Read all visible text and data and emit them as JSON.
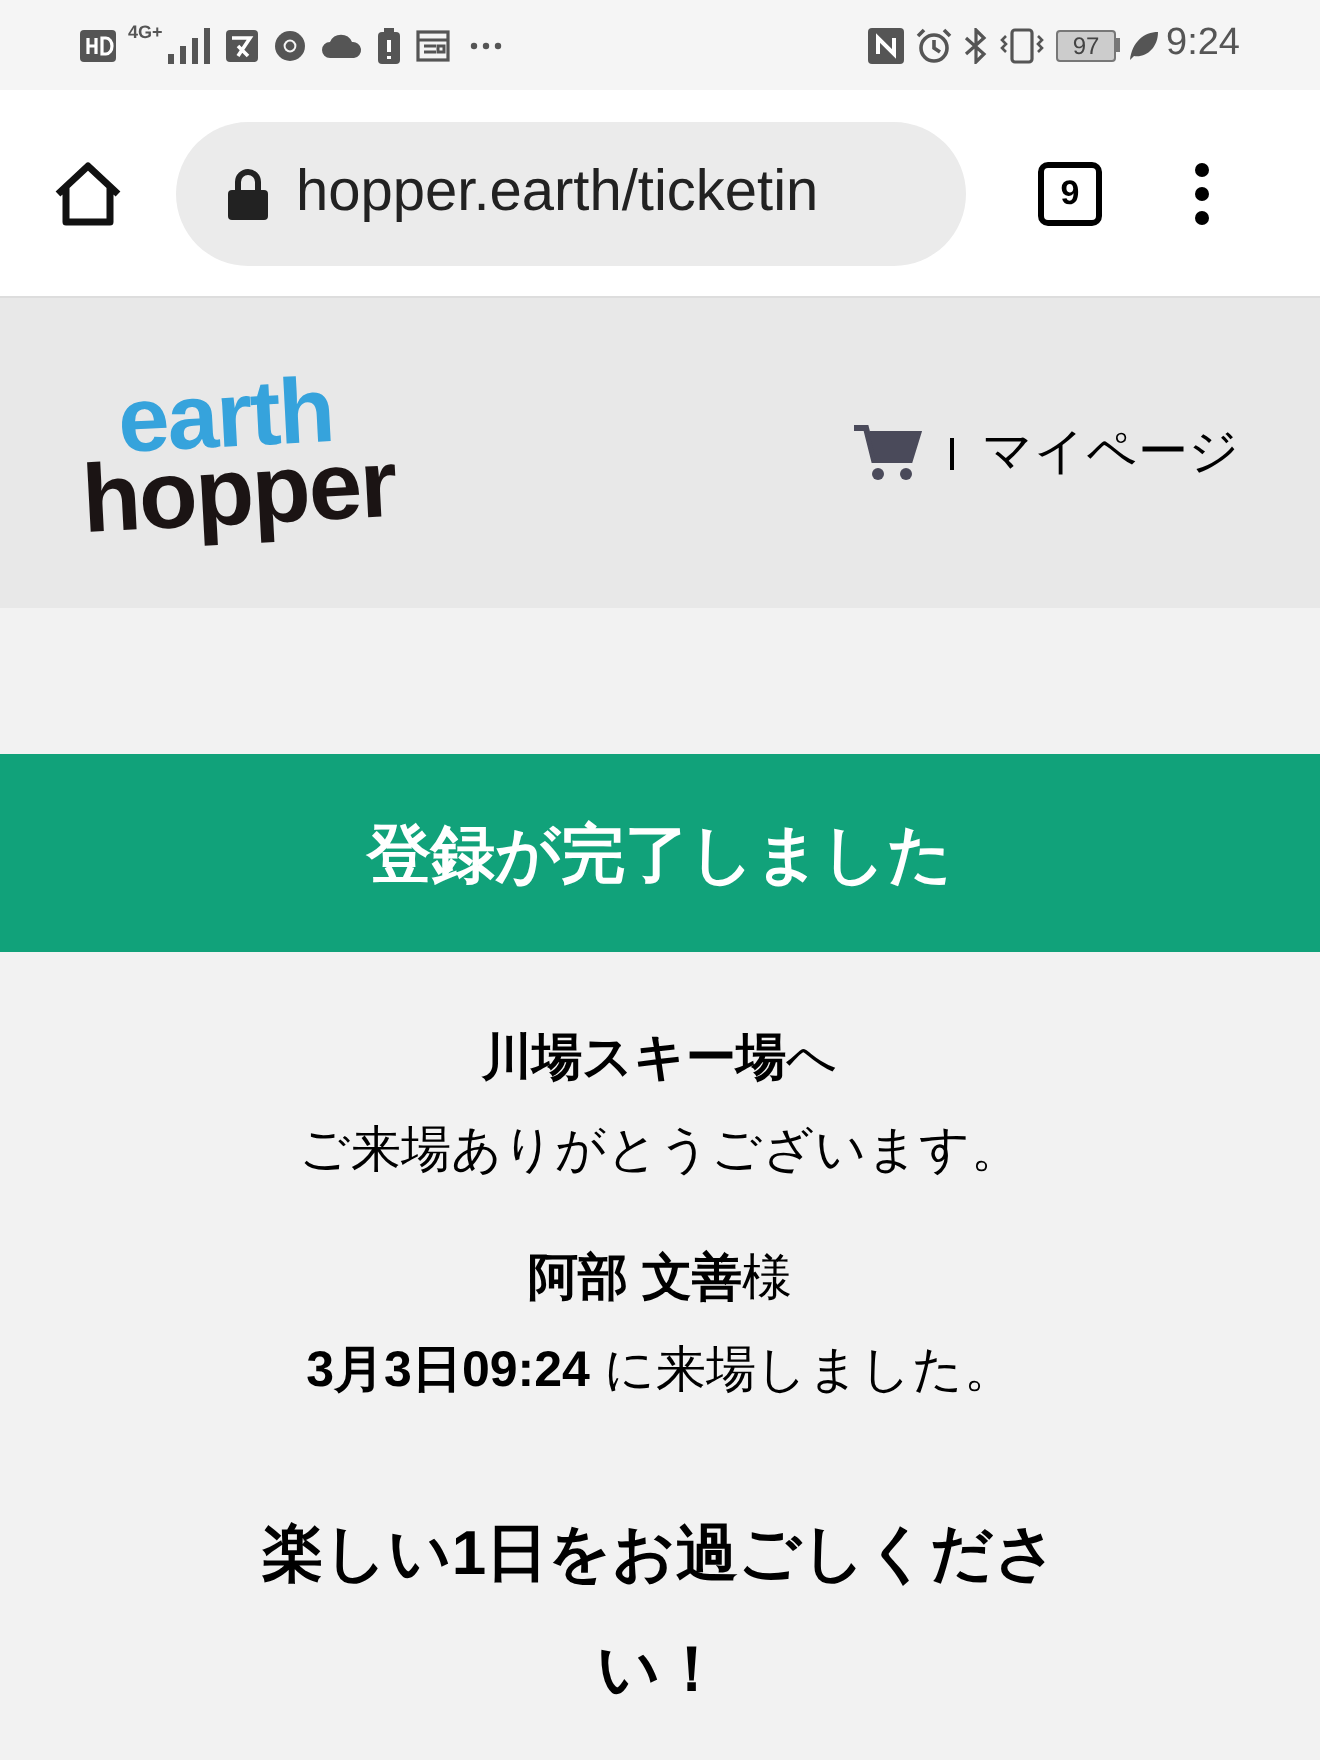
{
  "status_bar": {
    "network": "4G+",
    "battery": "97",
    "time": "9:24"
  },
  "browser": {
    "url": "hopper.earth/ticketin",
    "tab_count": "9"
  },
  "header": {
    "logo_top": "earth",
    "logo_bottom": "hopper",
    "mypage_link": "マイページ"
  },
  "banner": "登録が完了しました",
  "messages": [
    "**川場スキー場**へ",
    "ご来場ありがとうございます。",
    "**阿部 文善**様",
    "**3月3日09:24** に来場しました。"
  ],
  "closing": "楽しい1日をお過ごしください！"
}
